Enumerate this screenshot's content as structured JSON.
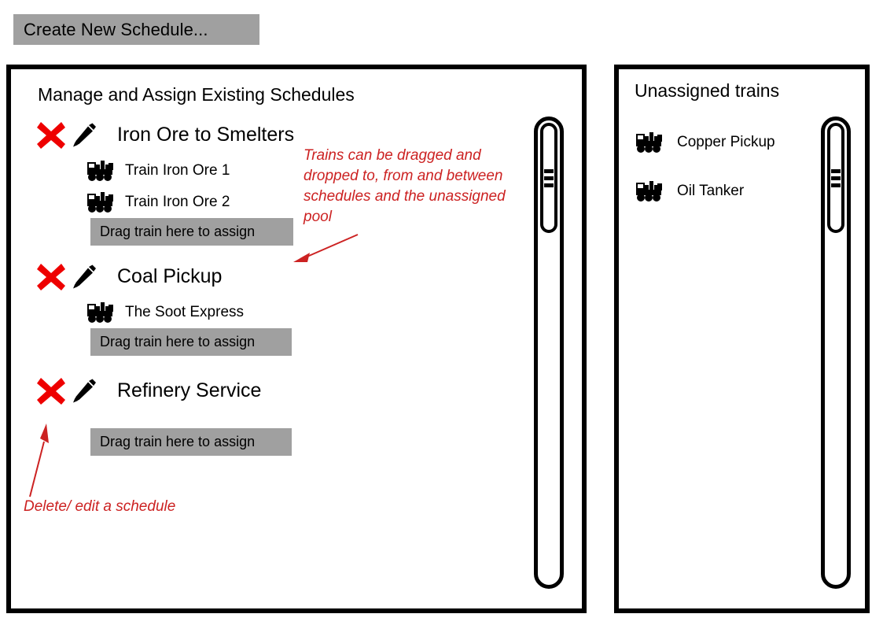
{
  "toolbar": {
    "create_schedule_label": "Create New Schedule..."
  },
  "colors": {
    "button_gray": "#a0a0a0",
    "annotation_red": "#cc2222",
    "delete_icon_red": "#ee0000",
    "panel_border": "#000000",
    "background": "#ffffff"
  },
  "left_panel": {
    "title": "Manage and Assign Existing Schedules",
    "schedules": [
      {
        "name": "Iron Ore to Smelters",
        "delete_icon": "x-mark-icon",
        "edit_icon": "pencil-icon",
        "trains": [
          {
            "name": "Train Iron Ore 1",
            "icon": "train-icon"
          },
          {
            "name": "Train Iron Ore 2",
            "icon": "train-icon"
          }
        ],
        "dropzone_label": "Drag train here to assign"
      },
      {
        "name": "Coal Pickup",
        "delete_icon": "x-mark-icon",
        "edit_icon": "pencil-icon",
        "trains": [
          {
            "name": "The Soot Express",
            "icon": "train-icon"
          }
        ],
        "dropzone_label": "Drag train here to assign"
      },
      {
        "name": "Refinery Service",
        "delete_icon": "x-mark-icon",
        "edit_icon": "pencil-icon",
        "trains": [],
        "dropzone_label": "Drag train here to assign"
      }
    ],
    "scrollbar": {
      "icon": "scrollbar-thumb-grip"
    }
  },
  "right_panel": {
    "title": "Unassigned trains",
    "trains": [
      {
        "name": "Copper Pickup",
        "icon": "train-icon"
      },
      {
        "name": "Oil Tanker",
        "icon": "train-icon"
      }
    ],
    "scrollbar": {
      "icon": "scrollbar-thumb-grip"
    }
  },
  "annotations": {
    "drag_note": "Trains can be dragged and dropped to, from and between schedules and the unassigned pool",
    "delete_note": "Delete/ edit a schedule"
  }
}
